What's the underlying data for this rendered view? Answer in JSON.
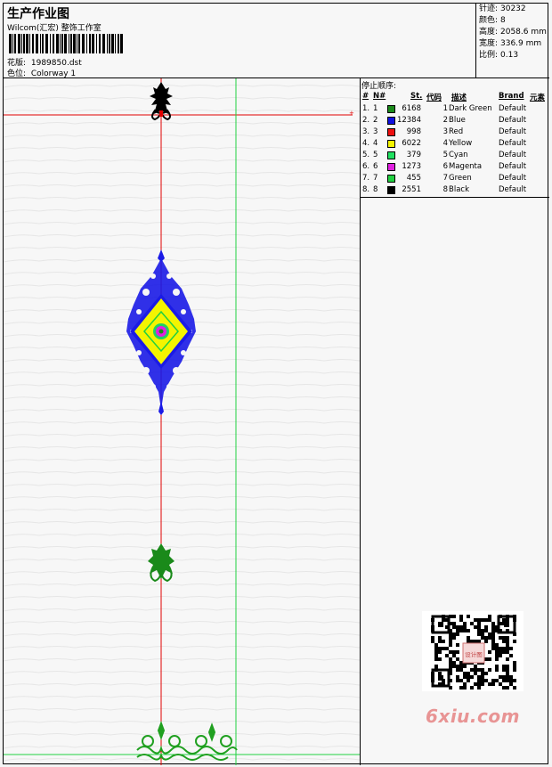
{
  "header": {
    "title": "生产作业图",
    "subtitle": "Wilcom(汇宏) 整饰工作室",
    "file_label": "花版:",
    "file_value": "1989850.dst",
    "colorway_label": "色位:",
    "colorway_value": "Colorway 1"
  },
  "stats": [
    {
      "label": "针迹:",
      "value": "30232"
    },
    {
      "label": "颜色:",
      "value": "8"
    },
    {
      "label": "高度:",
      "value": "2058.6 mm"
    },
    {
      "label": "宽度:",
      "value": "336.9 mm"
    },
    {
      "label": "比例:",
      "value": "0.13"
    }
  ],
  "stop_sequence": {
    "title": "停止顺序:",
    "columns": [
      "#",
      "N#",
      "St.",
      "代码",
      "描述",
      "Brand",
      "元素"
    ],
    "rows": [
      {
        "idx": "1.",
        "n": "1",
        "color": "#1a8a1a",
        "st": "6168",
        "code": "1",
        "desc": "Dark Green",
        "brand": "Default"
      },
      {
        "idx": "2.",
        "n": "2",
        "color": "#1010e0",
        "st": "12384",
        "code": "2",
        "desc": "Blue",
        "brand": "Default"
      },
      {
        "idx": "3.",
        "n": "3",
        "color": "#ee1010",
        "st": "998",
        "code": "3",
        "desc": "Red",
        "brand": "Default"
      },
      {
        "idx": "4.",
        "n": "4",
        "color": "#f4f400",
        "st": "6022",
        "code": "4",
        "desc": "Yellow",
        "brand": "Default"
      },
      {
        "idx": "5.",
        "n": "5",
        "color": "#20e060",
        "st": "379",
        "code": "5",
        "desc": "Cyan",
        "brand": "Default"
      },
      {
        "idx": "6.",
        "n": "6",
        "color": "#e020e0",
        "st": "1273",
        "code": "6",
        "desc": "Magenta",
        "brand": "Default"
      },
      {
        "idx": "7.",
        "n": "7",
        "color": "#20d040",
        "st": "455",
        "code": "7",
        "desc": "Green",
        "brand": "Default"
      },
      {
        "idx": "8.",
        "n": "8",
        "color": "#000000",
        "st": "2551",
        "code": "8",
        "desc": "Black",
        "brand": "Default"
      }
    ]
  },
  "watermark": "6xiu.com",
  "qr_badge": "设计图"
}
